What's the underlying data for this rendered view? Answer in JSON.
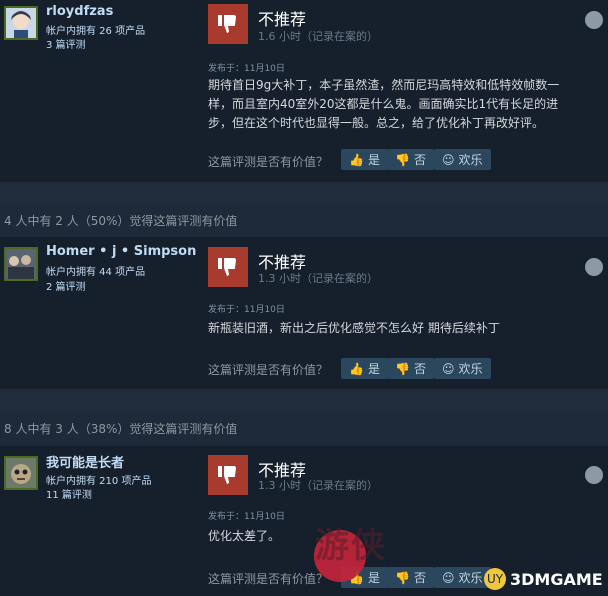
{
  "reviews": [
    {
      "username": "rloydfzas",
      "owned": "帐户内拥有 26 项产品",
      "review_count": "3 篇评测",
      "verdict": "不推荐",
      "hours": "1.6 小时（记录在案的）",
      "posted": "发布于：11月10日",
      "body_lines": [
        "期待首日9g大补丁，本子虽然渣，然而尼玛高特效和低特效帧数一",
        "样，而且室内40室外20这都是什么鬼。画面确实比1代有长足的进",
        "步，但在这个时代也显得一般。总之，给了优化补丁再改好评。"
      ],
      "question": "这篇评测是否有价值？",
      "yes": "是",
      "no": "否",
      "funny": "欢乐",
      "avatar_icon": "anime-avatar"
    },
    {
      "username": "Homer • j • Simpson",
      "owned": "帐户内拥有 44 项产品",
      "review_count": "2 篇评测",
      "verdict": "不推荐",
      "hours": "1.3 小时（记录在案的）",
      "posted": "发布于：11月10日",
      "body_lines": [
        "新瓶装旧酒，新出之后优化感觉不怎么好 期待后续补丁"
      ],
      "question": "这篇评测是否有价值？",
      "yes": "是",
      "no": "否",
      "funny": "欢乐",
      "avatar_icon": "group-avatar"
    },
    {
      "username": "我可能是长者",
      "owned": "帐户内拥有 210 项产品",
      "review_count": "11 篇评测",
      "verdict": "不推荐",
      "hours": "1.3 小时（记录在案的）",
      "posted": "发布于：11月10日",
      "body_lines": [
        "优化太差了。"
      ],
      "question": "这篇评测是否有价值？",
      "yes": "是",
      "no": "否",
      "funny": "欢乐",
      "avatar_icon": "creature-avatar"
    }
  ],
  "helpful_bars": [
    "4 人中有 2 人（50%）觉得这篇评测有价值",
    "8 人中有 3 人（38%）觉得这篇评测有价值"
  ],
  "watermark": {
    "text": "游侠",
    "badge": "3DMGAME",
    "badge_prefix": "UY"
  },
  "colors": {
    "thumb_down_bg": "#a83a2e",
    "username": "#c1dbf4",
    "vote_button_bg": "#2a475e"
  },
  "icons": {
    "thumb_down": "thumb-down-icon",
    "thumb_up_small": "thumb-up-icon",
    "thumb_down_small": "thumb-down-icon",
    "smiley": "smiley-icon",
    "steam": "steam-icon"
  }
}
